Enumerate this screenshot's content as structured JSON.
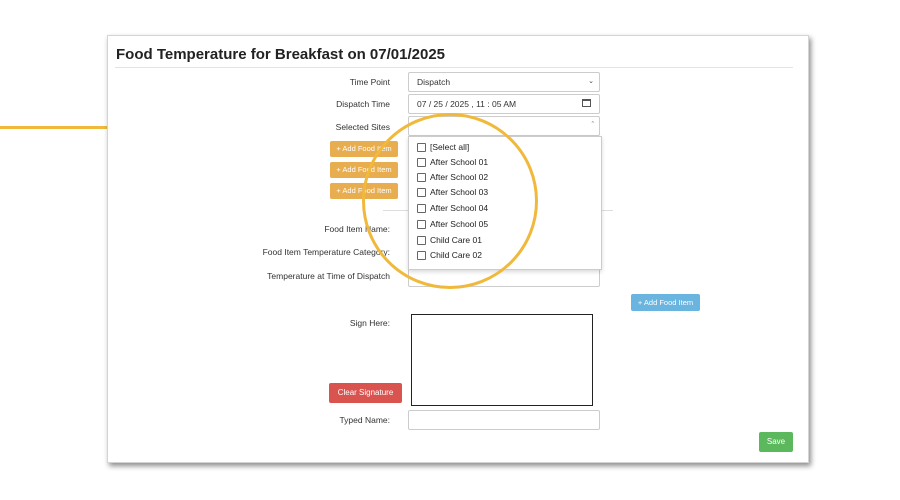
{
  "page": {
    "title": "Food Temperature for Breakfast on 07/01/2025"
  },
  "form": {
    "time_point_label": "Time Point",
    "time_point_value": "Dispatch",
    "dispatch_time_label": "Dispatch Time",
    "dispatch_time_value": "07 / 25 / 2025 , 11 : 05  AM",
    "selected_sites_label": "Selected Sites",
    "food_item_name_label": "Food Item Name:",
    "food_item_temp_category_label": "Food Item Temperature Category:",
    "temperature_dispatch_label": "Temperature at Time of Dispatch",
    "sign_here_label": "Sign Here:",
    "typed_name_label": "Typed Name:"
  },
  "buttons": {
    "add_food_item": "+ Add Food Item",
    "clear_signature": "Clear Signature",
    "save": "Save"
  },
  "sites_dropdown": {
    "items": [
      "[Select all]",
      "After School 01",
      "After School 02",
      "After School 03",
      "After School 04",
      "After School 05",
      "Child Care 01",
      "Child Care 02"
    ]
  },
  "colors": {
    "annotation": "#f0b93c",
    "add_item_orange": "#e7ad4f",
    "add_item_blue": "#6ab4e0",
    "clear_red": "#d9534f",
    "save_green": "#5cb85c"
  }
}
